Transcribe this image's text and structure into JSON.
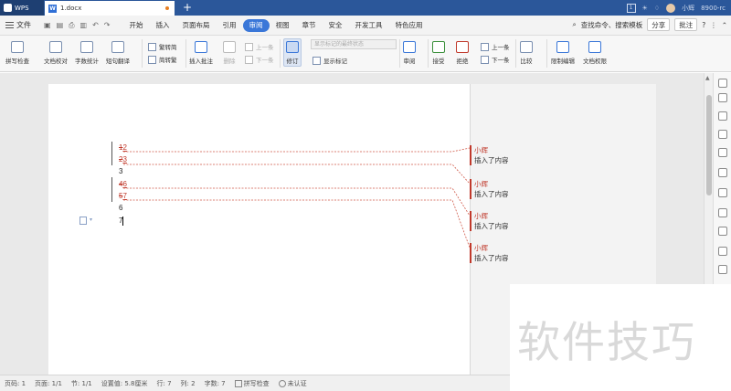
{
  "titlebar": {
    "app_name": "WPS",
    "doc_tab": "1.docx",
    "new_tab": "+",
    "user": "小辉",
    "badge": "8900-rc",
    "page_indicator": "1"
  },
  "menubar": {
    "file": "文件",
    "tabs": [
      "开始",
      "插入",
      "页面布局",
      "引用",
      "审阅",
      "视图",
      "章节",
      "安全",
      "开发工具",
      "特色应用"
    ],
    "active_tab": "审阅",
    "search": "查找命令、搜索模板",
    "share": "分享",
    "comment": "批注"
  },
  "ribbon": {
    "spellcheck": "拼写检查",
    "proofread": "文档校对",
    "wordcount": "字数统计",
    "translate": "短句翻译",
    "to_simplified": "繁转简",
    "to_traditional": "简转繁",
    "insert_comment": "插入批注",
    "delete": "删除",
    "prev": "上一条",
    "next": "下一条",
    "track_changes": "修订",
    "markup_dropdown": "显示标记的最终状态",
    "show_markup": "显示标记",
    "review": "审阅",
    "accept": "接受",
    "reject": "拒绝",
    "prev_change": "上一条",
    "next_change": "下一条",
    "compare": "比较",
    "restrict": "限制编辑",
    "permission": "文档权限"
  },
  "document": {
    "lines": [
      {
        "del": "1",
        "ins": "2"
      },
      {
        "del": "2",
        "ins": "3"
      },
      {
        "text": "3"
      },
      {
        "del": "4",
        "ins": "6"
      },
      {
        "del": "5",
        "ins": "7"
      },
      {
        "text": "6"
      },
      {
        "text": "7"
      }
    ],
    "comments": [
      {
        "author": "小辉",
        "text": "插入了内容"
      },
      {
        "author": "小辉",
        "text": "插入了内容"
      },
      {
        "author": "小辉",
        "text": "插入了内容"
      },
      {
        "author": "小辉",
        "text": "插入了内容"
      }
    ]
  },
  "statusbar": {
    "page_num": "页码: 1",
    "page": "页面: 1/1",
    "section": "节: 1/1",
    "setting": "设置值: 5.8厘米",
    "row": "行: 7",
    "col": "列: 2",
    "words": "字数: 7",
    "spell": "拼写检查",
    "cert": "未认证"
  },
  "watermark": "软件技巧",
  "colors": {
    "title_bg": "#2b579a",
    "accent": "#3a77d8",
    "revision": "#c0392b"
  }
}
